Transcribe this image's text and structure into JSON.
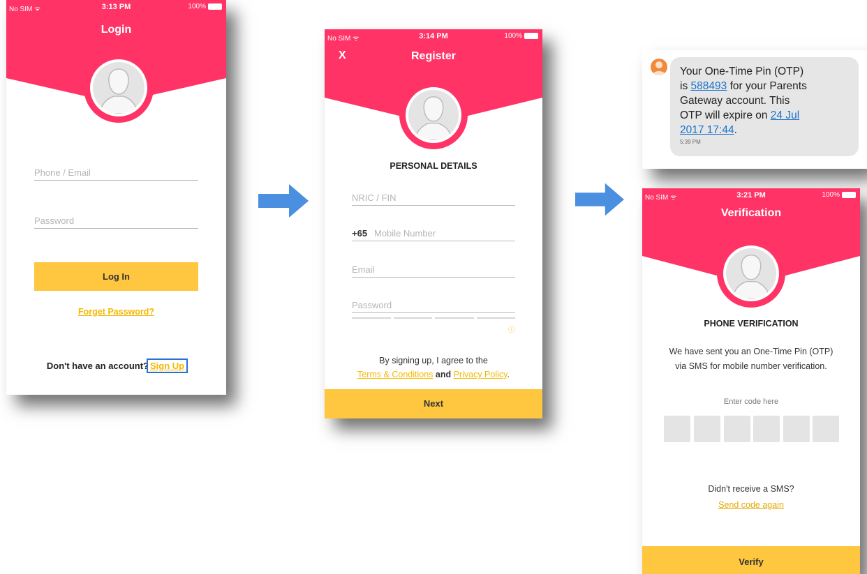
{
  "colors": {
    "brand": "#ff3366",
    "accent": "#ffc740",
    "link": "#f5b800"
  },
  "status_bar": {
    "carrier": "No SIM",
    "battery": "100%"
  },
  "login": {
    "time": "3:13 PM",
    "title": "Login",
    "phone_placeholder": "Phone / Email",
    "password_placeholder": "Password",
    "login_button": "Log In",
    "forget_link": "Forget Password?",
    "no_account_text": "Don't have an account?",
    "signup_link": "Sign Up"
  },
  "register": {
    "time": "3:14 PM",
    "close_label": "X",
    "title": "Register",
    "section_title": "PERSONAL DETAILS",
    "nric_placeholder": "NRIC / FIN",
    "country_code": "+65",
    "mobile_placeholder": "Mobile Number",
    "email_placeholder": "Email",
    "password_placeholder": "Password",
    "info_icon": "ⓘ",
    "terms_prefix": "By signing up, I agree to the",
    "terms_link": "Terms & Conditions",
    "and_text": "and",
    "privacy_link": "Privacy Policy",
    "period": ".",
    "next_button": "Next"
  },
  "sms": {
    "line1": "Your One-Time Pin (OTP)",
    "is": "is",
    "code": "588493",
    "for_text": "for your Parents",
    "line3": "Gateway account. This",
    "line4": "OTP will expire on",
    "date1": "24 Jul",
    "date2": "2017 17:44",
    "period": ".",
    "timestamp": "5:39 PM"
  },
  "verification": {
    "time": "3:21 PM",
    "title": "Verification",
    "section_title": "PHONE VERIFICATION",
    "message_line1": "We have sent you an One-Time Pin (OTP)",
    "message_line2": "via SMS for mobile number verification.",
    "code_label": "Enter code here",
    "code_boxes": [
      "",
      "",
      "",
      "",
      "",
      ""
    ],
    "no_sms_text": "Didn't receive a SMS?",
    "resend_link": "Send code again",
    "verify_button": "Verify"
  }
}
